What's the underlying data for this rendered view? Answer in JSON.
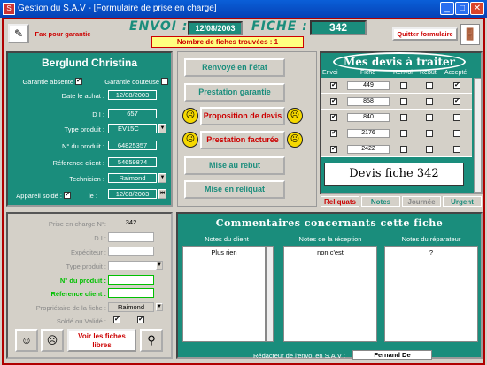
{
  "window": {
    "title": "Gestion du S.A.V - [Formulaire de prise en charge]"
  },
  "header": {
    "fax_label": "Fax pour garantie",
    "envoi_label": "ENVOI :",
    "envoi_date": "12/08/2003",
    "fiche_label": "FICHE :",
    "fiche_number": "342",
    "count_text": "Nombre de fiches trouvées : 1",
    "quit_label": "Quitter formulaire"
  },
  "client": {
    "name": "Berglund   Christina",
    "garantie_absente": "Garantie absente",
    "garantie_douteuse": "Garantie douteuse",
    "date_achat_label": "Date le achat :",
    "date_achat": "12/08/2003",
    "di_label": "D I :",
    "di": "657",
    "type_label": "Type produit :",
    "type": "EV15C",
    "num_produit_label": "N° du produit :",
    "num_produit": "64825357",
    "ref_client_label": "Réference client :",
    "ref_client": "54659874",
    "technicien_label": "Technicien :",
    "technicien": "Raimond",
    "solde_label": "Appareil soldé :",
    "le_label": "le :",
    "solde_date": "12/08/2003"
  },
  "actions": [
    {
      "label": "Renvoyé en l'état"
    },
    {
      "label": "Prestation garantie"
    },
    {
      "label": "Proposition de devis"
    },
    {
      "label": "Prestation facturée"
    },
    {
      "label": "Mise au  rebut"
    },
    {
      "label": "Mise en reliquat"
    }
  ],
  "devis": {
    "title": "Mes devis à traiter",
    "col_envoi": "Envoi",
    "col_fiche": "Fiche",
    "col_renvoi": "Renvoi",
    "col_rebut": "Rebut",
    "col_accepte": "Accepté",
    "rows": [
      {
        "fiche": "449",
        "envoi": "✔",
        "renvoi": "",
        "rebut": "",
        "accepte": "✔"
      },
      {
        "fiche": "858",
        "envoi": "✔",
        "renvoi": "",
        "rebut": "",
        "accepte": "✔"
      },
      {
        "fiche": "840",
        "envoi": "✔",
        "renvoi": "",
        "rebut": "",
        "accepte": ""
      },
      {
        "fiche": "2176",
        "envoi": "✔",
        "renvoi": "",
        "rebut": "",
        "accepte": ""
      },
      {
        "fiche": "2422",
        "envoi": "✔",
        "renvoi": "",
        "rebut": "",
        "accepte": ""
      }
    ],
    "devis_fiche": "Devis fiche 342"
  },
  "tabs": [
    {
      "label": "Reliquats",
      "color": "#cc0000"
    },
    {
      "label": "Notes",
      "color": "#1a8d7c"
    },
    {
      "label": "Journée",
      "color": "#888888"
    },
    {
      "label": "Urgent",
      "color": "#1a8d7c"
    }
  ],
  "prise": {
    "prise_label": "Prise en charge N°:",
    "prise_val": "342",
    "di_label": "D I :",
    "exp_label": "Expéditeur :",
    "type_label": "Type produit :",
    "num_label": "N° du produit :",
    "ref_label": "Réference client :",
    "prop_label": "Propriétaire de la fiche :",
    "prop_val": "Raimond",
    "solde_label": "Soldé ou Validé :",
    "voir_label": "Voir les fiches libres"
  },
  "comments": {
    "title": "Commentaires  concernants  cette  fiche",
    "client_label": "Notes du client",
    "client_text": "Plus rien",
    "reception_label": "Notes de la réception",
    "reception_text": "non c'est",
    "reparateur_label": "Notes du réparateur",
    "reparateur_text": "?",
    "redacteur_label": "Rédacteur de l'envoi en S.A.V :",
    "redacteur_val": "Fernand De"
  }
}
